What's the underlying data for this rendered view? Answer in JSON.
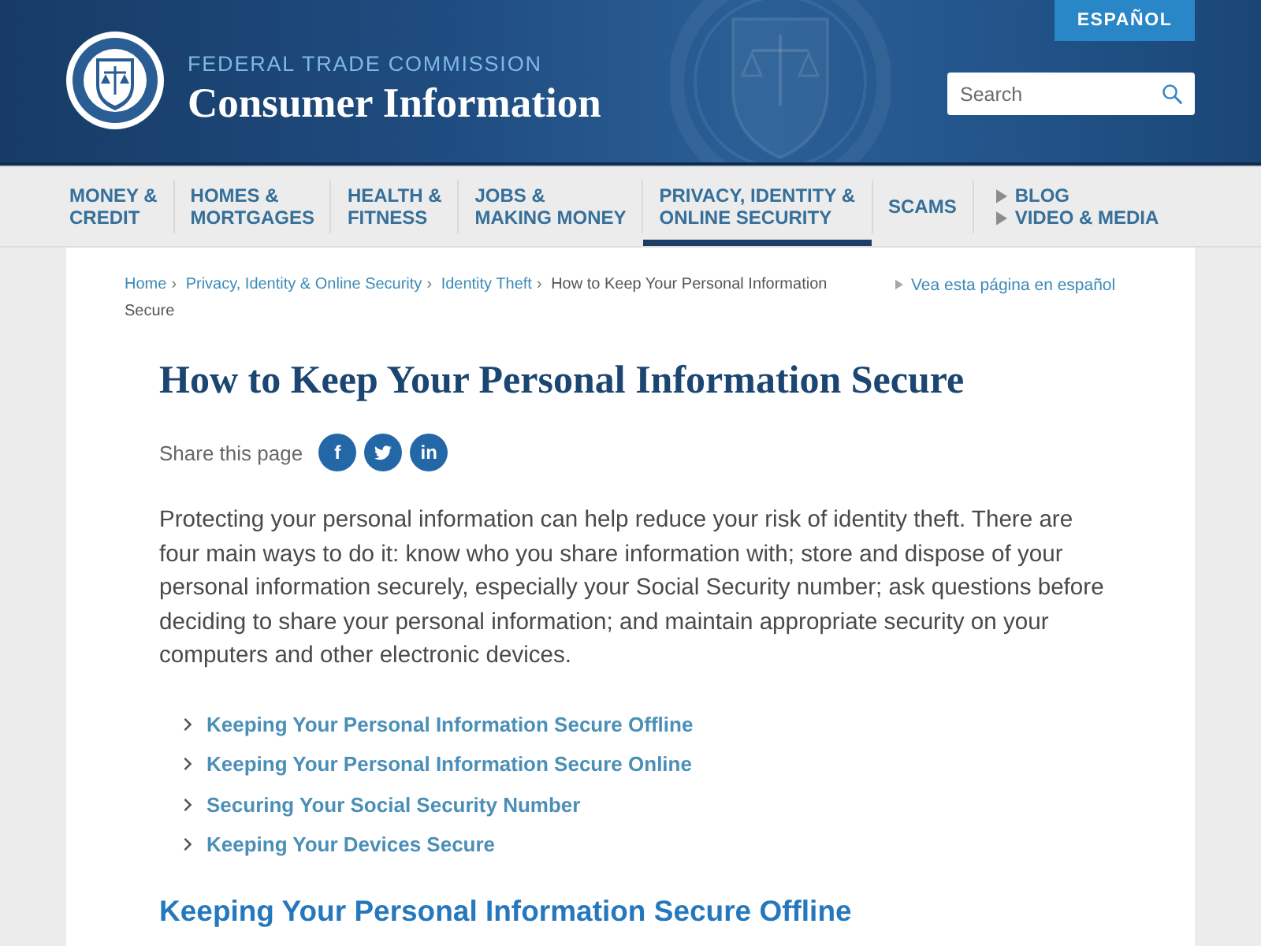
{
  "header": {
    "agency": "FEDERAL TRADE COMMISSION",
    "site_title": "Consumer Information",
    "language_button": "ESPAÑOL",
    "search": {
      "placeholder": "Search"
    }
  },
  "nav": {
    "items": [
      {
        "label": "MONEY &\nCREDIT",
        "selected": false
      },
      {
        "label": "HOMES &\nMORTGAGES",
        "selected": false
      },
      {
        "label": "HEALTH &\nFITNESS",
        "selected": false
      },
      {
        "label": "JOBS &\nMAKING MONEY",
        "selected": false
      },
      {
        "label": "PRIVACY, IDENTITY &\nONLINE SECURITY",
        "selected": true
      },
      {
        "label": "SCAMS",
        "selected": false
      }
    ],
    "extra_links": [
      "BLOG",
      "VIDEO & MEDIA"
    ]
  },
  "breadcrumb": {
    "items": [
      {
        "kind": "link",
        "label": "Home"
      },
      {
        "kind": "link",
        "label": "Privacy, Identity & Online Security"
      },
      {
        "kind": "link",
        "label": "Identity Theft"
      },
      {
        "kind": "current",
        "label": "How to Keep Your Personal Information Secure"
      }
    ],
    "separators": [
      "›",
      "›",
      "›"
    ]
  },
  "language_link": "Vea esta página en español",
  "article": {
    "title": "How to Keep Your Personal Information Secure",
    "share": {
      "label": "Share this page",
      "buttons": [
        {
          "kind": "letter",
          "label": "f"
        },
        {
          "kind": "drawing"
        },
        {
          "kind": "letter",
          "label": "in"
        }
      ]
    },
    "intro": "Protecting your personal information can help reduce your risk of identity theft. There are four main ways to do it: know who you share information with; store and dispose of your personal information securely, especially your Social Security number; ask questions before deciding to share your personal information; and maintain appropriate security on your computers and other electronic devices.",
    "section_links": [
      "Keeping Your Personal Information Secure Offline",
      "Keeping Your Personal Information Secure Online",
      "Securing Your Social Security Number",
      "Keeping Your Devices Secure"
    ],
    "section_heading": "Keeping Your Personal Information Secure Offline"
  }
}
